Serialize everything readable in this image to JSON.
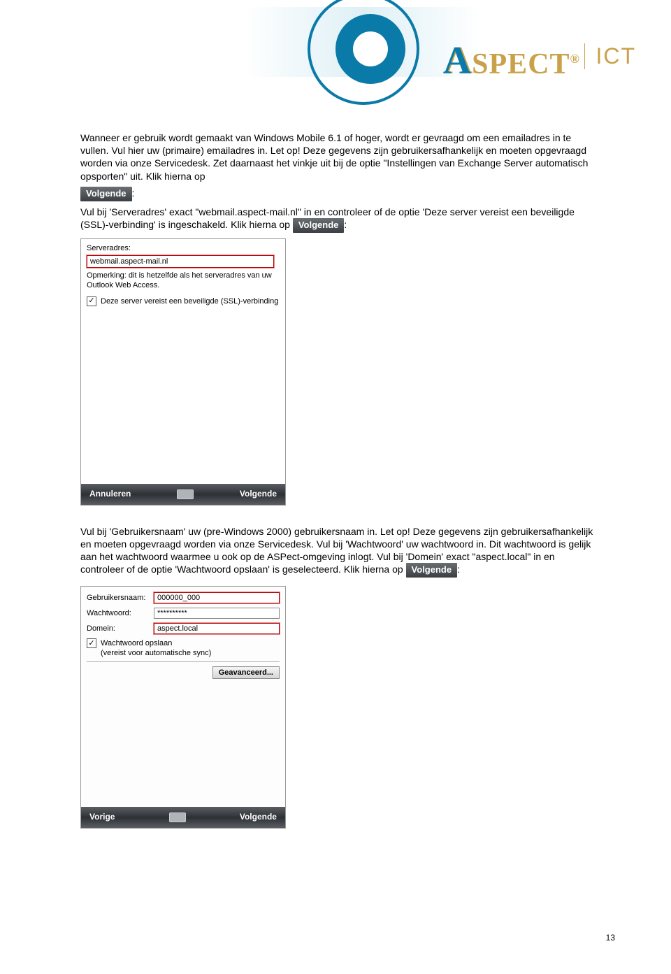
{
  "header": {
    "brand": "SPECT",
    "brand_prefix": "A",
    "reg": "®",
    "suffix": "ICT"
  },
  "page_number": "13",
  "para1": "Wanneer er gebruik wordt gemaakt van Windows Mobile 6.1 of hoger, wordt er gevraagd om een emailadres in te vullen. Vul hier uw (primaire) emailadres in. Let op! Deze gegevens zijn gebruikersafhankelijk en moeten opgevraagd worden via onze Servicedesk. Zet daarnaast het vinkje uit bij de optie \"Instellingen van Exchange Server automatisch opsporten\" uit. Klik hierna op",
  "volgende_btn": "Volgende",
  "para1_suffix": ":",
  "para2_a": "Vul bij 'Serveradres' exact \"webmail.aspect-mail.nl\" in en controleer of de optie 'Deze server vereist een beveiligde (SSL)-verbinding' is ingeschakeld. Klik hierna op ",
  "para2_suffix": ":",
  "screenshot1": {
    "label": "Serveradres:",
    "input_value": "webmail.aspect-mail.nl",
    "note": "Opmerking: dit is hetzelfde als het serveradres van uw Outlook Web Access.",
    "checkbox_label": "Deze server vereist een beveiligde (SSL)-verbinding",
    "footer_left": "Annuleren",
    "footer_right": "Volgende"
  },
  "para3": "Vul bij 'Gebruikersnaam' uw (pre-Windows 2000) gebruikersnaam in. Let op! Deze gegevens zijn gebruikersafhankelijk en moeten opgevraagd worden via onze Servicedesk. Vul bij 'Wachtwoord' uw wachtwoord in. Dit wachtwoord is gelijk aan het wachtwoord waarmee u ook op de ASPect-omgeving inlogt. Vul bij 'Domein' exact \"aspect.local\" in en controleer of de optie 'Wachtwoord opslaan' is geselecteerd. Klik hierna op ",
  "para3_suffix": ":",
  "screenshot2": {
    "user_label": "Gebruikersnaam:",
    "user_value": "000000_000",
    "pass_label": "Wachtwoord:",
    "pass_value": "**********",
    "domain_label": "Domein:",
    "domain_value": "aspect.local",
    "save_pw_label": "Wachtwoord opslaan",
    "save_pw_note": "(vereist voor automatische sync)",
    "advanced_btn": "Geavanceerd...",
    "footer_left": "Vorige",
    "footer_right": "Volgende"
  }
}
